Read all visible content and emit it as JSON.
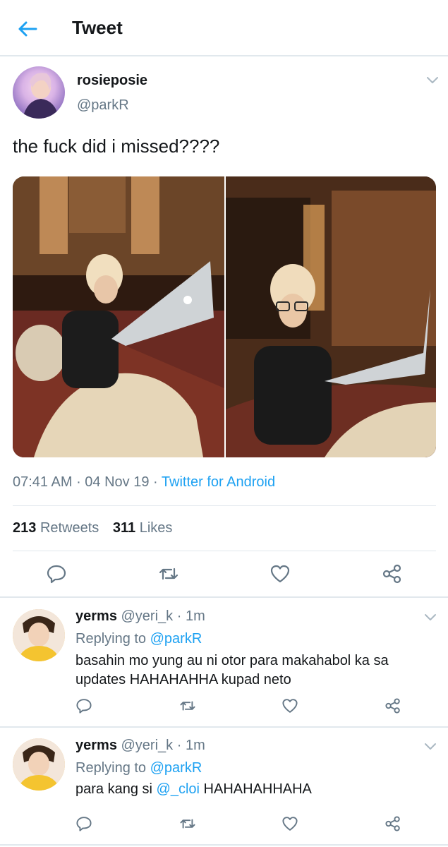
{
  "header": {
    "title": "Tweet",
    "back_icon": "arrow-left-icon",
    "accent": "#1da1f2"
  },
  "tweet": {
    "display_name": "rosieposie",
    "handle": "@parkR",
    "text": "the fuck did i missed????",
    "time": "07:41 AM",
    "date": "04 Nov 19",
    "source": "Twitter for Android",
    "retweets_count": "213",
    "retweets_label": "Retweets",
    "likes_count": "311",
    "likes_label": "Likes",
    "actions": [
      "reply-icon",
      "retweet-icon",
      "like-icon",
      "share-icon"
    ]
  },
  "replies": [
    {
      "display_name": "yerms",
      "handle": "@yeri_k",
      "time": "1m",
      "replying_prefix": "Replying to",
      "replying_handle": "@parkR",
      "text": "basahin mo yung au ni otor para makahabol ka sa updates HAHAHAHHA kupad neto"
    },
    {
      "display_name": "yerms",
      "handle": "@yeri_k",
      "time": "1m",
      "replying_prefix": "Replying to",
      "replying_handle": "@parkR",
      "text_prefix": "para kang si",
      "mention": "@_cloi",
      "text_suffix": "HAHAHAHHAHA"
    }
  ]
}
